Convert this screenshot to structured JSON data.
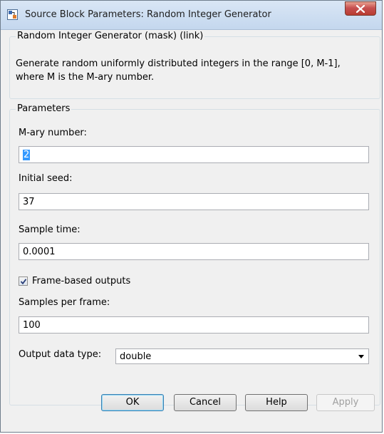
{
  "window": {
    "title": "Source Block Parameters: Random Integer Generator"
  },
  "mask": {
    "legend": "Random Integer Generator (mask) (link)",
    "description_line1": "Generate random uniformly distributed integers in the range [0, M-1],",
    "description_line2": "where M is the M-ary number."
  },
  "parameters": {
    "legend": "Parameters",
    "mary_label": "M-ary number:",
    "mary_value": "2",
    "seed_label": "Initial seed:",
    "seed_value": "37",
    "sample_time_label": "Sample time:",
    "sample_time_value": "0.0001",
    "frame_based_label": "Frame-based outputs",
    "frame_based_checked": true,
    "samples_per_frame_label": "Samples per frame:",
    "samples_per_frame_value": "100",
    "output_type_label": "Output data type:",
    "output_type_value": "double"
  },
  "buttons": {
    "ok": "OK",
    "cancel": "Cancel",
    "help": "Help",
    "apply": "Apply"
  },
  "icons": {
    "app": "simulink-block-icon",
    "close": "close-icon",
    "check": "checkmark-icon",
    "dropdown": "chevron-down-icon"
  },
  "colors": {
    "close_button": "#c75050",
    "selection": "#3399ff",
    "ok_focus": "#3c7fb1"
  }
}
